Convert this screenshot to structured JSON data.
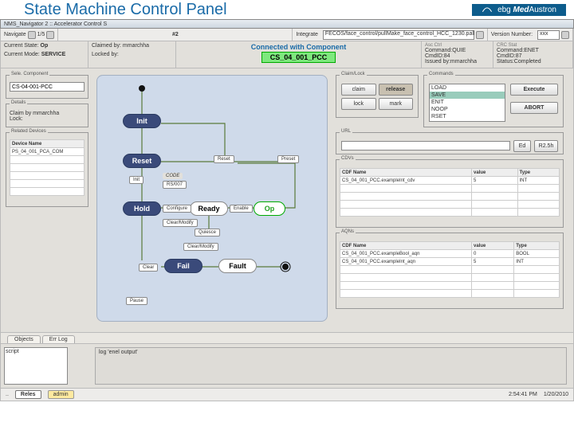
{
  "page": {
    "title": "State Machine Control Panel"
  },
  "brand_prefix": "ebg",
  "brand_em": "Med",
  "brand_suffix": "Austron",
  "window_title": "NMS_Navigator 2 :: Accelerator Control S",
  "toolbar": {
    "nav_label": "Navigate",
    "nav_pos": "1/5",
    "hash_label": "#2",
    "integrate_label": "Integrate",
    "integrate_path": "FECOS/face_control/pullMake_face_control_HCC_1230.pall",
    "version_label": "Version Number:",
    "version_val": "xxx"
  },
  "status": {
    "current_state_label": "Current State:",
    "current_state": "Op",
    "current_mode_label": "Current Mode:",
    "current_mode": "SERVICE",
    "claimed_label": "Claimed by:",
    "claimed_by": "mmarchha",
    "locked_label": "Locked by:",
    "locked_by": "",
    "connected_label": "Connected with Component",
    "component": "CS_04_001_PCC"
  },
  "asc_ctrl": {
    "legend": "Asc Ctrl",
    "l1": "Command:QUIE",
    "l2": "CmdID:84",
    "l3": "Issued by:mmarchha"
  },
  "crc_stat": {
    "legend": "CRC Stat",
    "l1": "Command:ENET",
    "l2": "CmdID:87",
    "l3": "Status:Completed"
  },
  "selcomp": {
    "legend": "Sele. Component",
    "value": "CS-04-001-PCC"
  },
  "details": {
    "legend": "Details",
    "claim": "Claim by mmarchha",
    "lock": "Lock:"
  },
  "related": {
    "legend": "Related Devices",
    "header": "Device Name",
    "rows": [
      "PS_04_001_PCA_COM"
    ]
  },
  "claimlock": {
    "legend": "Claim/Lock",
    "claim": "claim",
    "release": "release",
    "lock": "lock",
    "mark": "mark"
  },
  "commands": {
    "legend": "Commands",
    "items": [
      "LOAD",
      "SAVE",
      "ENIT",
      "NOOP",
      "RSET"
    ],
    "execute": "Execute",
    "abort": "ABORT"
  },
  "url": {
    "legend": "URL",
    "value": "",
    "ed": "Ed",
    "r2": "R2.5h"
  },
  "cdvs": {
    "legend": "CDVs",
    "headers": [
      "CDF Name",
      "value",
      "Type"
    ],
    "rows": [
      [
        "CS_04_001_PCC.exampleInt_cdv",
        "5",
        "INT"
      ]
    ]
  },
  "aqns": {
    "legend": "AQNs",
    "headers": [
      "CDF Name",
      "value",
      "Type"
    ],
    "rows": [
      [
        "CS_04_001_PCC.exampleBool_aqn",
        "0",
        "BOOL"
      ],
      [
        "CS_04_001_PCC.exampleInt_aqn",
        "5",
        "INT"
      ]
    ]
  },
  "diagram": {
    "nodes": {
      "init": "Init",
      "reset": "Reset",
      "hold": "Hold",
      "ready": "Ready",
      "op": "Op",
      "fail": "Fail",
      "fault": "Fault"
    },
    "trans": {
      "reset": "Reset",
      "preset": "Preset",
      "init": "Init",
      "code": "CODE",
      "rs007": "RS/007",
      "configure": "Configure",
      "enable": "Enable",
      "clear_modify": "Clear/Modify",
      "quiesce": "Quiesce",
      "clear_modify2": "Clear/Modify",
      "clear": "Clear",
      "pause": "Pause"
    }
  },
  "tabs": {
    "objects": "Objects",
    "errlog": "Err Log"
  },
  "log": {
    "script": "script",
    "output": "log 'enel output'"
  },
  "statusbar": {
    "reles": "Reles",
    "role": "admin",
    "time": "2:54:41 PM",
    "date": "1/20/2010"
  }
}
